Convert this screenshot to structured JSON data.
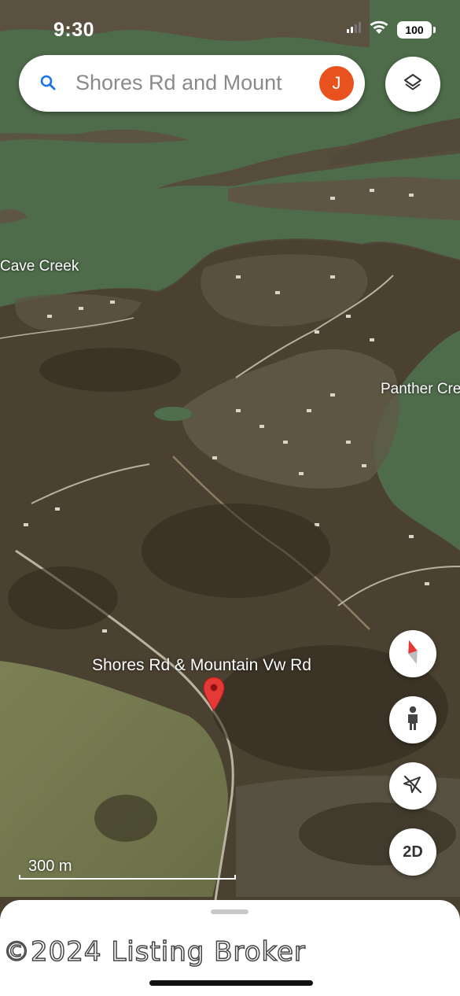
{
  "status_bar": {
    "time": "9:30",
    "battery": "100"
  },
  "search": {
    "query": "Shores Rd and Mount",
    "avatar_initial": "J"
  },
  "map": {
    "labels": {
      "cave_creek": "Cave Creek",
      "panther_creek": "Panther Cre",
      "pin": "Shores Rd & Mountain Vw Rd"
    },
    "scale": "300 m"
  },
  "controls": {
    "layers": "layers-icon",
    "compass": "compass-icon",
    "street_view": "pegman-icon",
    "location": "location-off-icon",
    "view_mode": "2D"
  },
  "sheet": {
    "watermark": "©2024 Listing Broker"
  },
  "colors": {
    "water": "#4e6b4a",
    "land": "#4a4132",
    "pin": "#e53935",
    "avatar": "#e8521f"
  }
}
